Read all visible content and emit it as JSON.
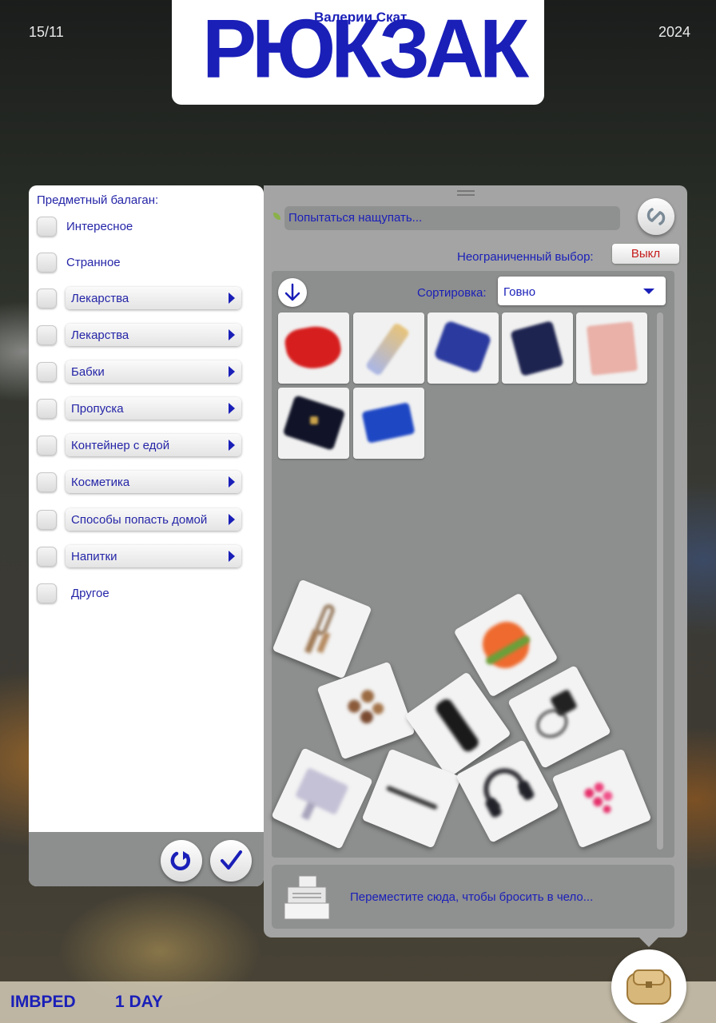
{
  "header": {
    "issue": "15/11",
    "year": "2024",
    "logo_author": "Валерии Скат",
    "logo_title": "РЮКЗАК"
  },
  "left_panel": {
    "title": "Предметный балаган:",
    "categories": [
      {
        "label": "Интересное",
        "submenu": false
      },
      {
        "label": "Странное",
        "submenu": false
      },
      {
        "label": "Лекарства",
        "submenu": true
      },
      {
        "label": "Лекарства",
        "submenu": true
      },
      {
        "label": "Бабки",
        "submenu": true
      },
      {
        "label": "Пропуска",
        "submenu": true
      },
      {
        "label": "Контейнер с едой",
        "submenu": true
      },
      {
        "label": "Косметика",
        "submenu": true
      },
      {
        "label": "Способы попасть домой",
        "submenu": true
      },
      {
        "label": "Напитки",
        "submenu": true
      },
      {
        "label": "Другое",
        "submenu": false
      }
    ],
    "reset_icon": "reset-icon",
    "confirm_icon": "check-icon"
  },
  "right_panel": {
    "search_placeholder": "Попытаться нащупать...",
    "unlimited_label": "Неограниченный выбор:",
    "unlimited_value": "Выкл",
    "sort_label": "Сортировка:",
    "sort_value": "Говно",
    "drop_text": "Переместите сюда, чтобы бросить в чело...",
    "inventory_items": [
      "red-scarf-icon",
      "tube-icon",
      "blue-pouch-icon",
      "dark-pouch-icon",
      "makeup-palette-icon",
      "black-wallet-icon",
      "blue-card-icon"
    ],
    "floating_items": [
      "keys-icon",
      "sandwich-icon",
      "coins-icon",
      "water-bottle-icon",
      "charger-icon",
      "laptop-icon",
      "pen-icon",
      "headphones-icon",
      "pills-icon"
    ]
  },
  "bottom_bar": {
    "left_text": "IMBPED",
    "day_text": "1 DAY"
  },
  "colors": {
    "accent": "#1a1fb8",
    "toggle_off": "#c51a1a",
    "panel_gray": "#a3a4a3"
  }
}
